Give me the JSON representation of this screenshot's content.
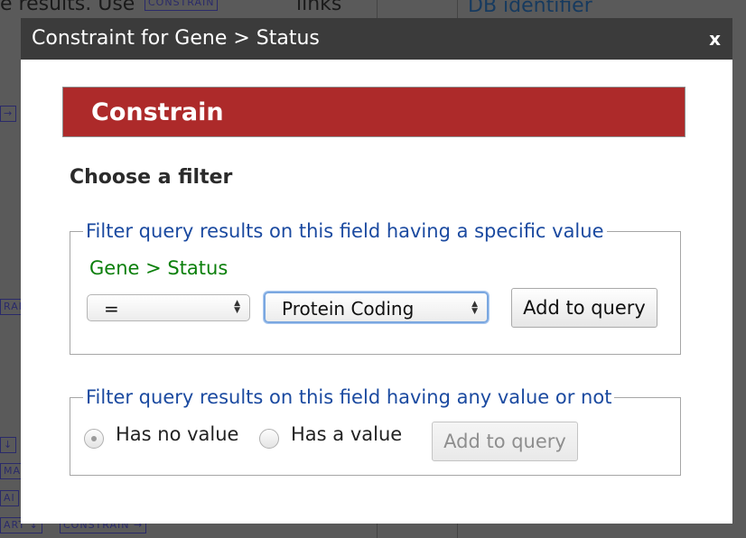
{
  "background": {
    "text_top_left": "e results. Use",
    "box_top": "CONSTRAIN",
    "text_links": "links",
    "db_identifier": "DB identifier",
    "left_box_1": "→",
    "left_box_2": "RAIN",
    "left_box_3": "↓",
    "left_box_4": "MAI",
    "left_box_5": "AI",
    "left_box_6": "ART ↓",
    "bottom_box": "CONSTRAIN →"
  },
  "modal": {
    "title": "Constraint for Gene > Status",
    "close_label": "x",
    "banner": "Constrain",
    "heading": "Choose a filter",
    "specific_value": {
      "legend": "Filter query results on this field having a specific value",
      "field_path": "Gene > Status",
      "operator": "=",
      "value": "Protein Coding",
      "button": "Add to query"
    },
    "any_value": {
      "legend": "Filter query results on this field having any value or not",
      "option_no_value": "Has no value",
      "option_has_value": "Has a value",
      "selected": "Has no value",
      "button": "Add to query",
      "button_disabled": true
    }
  },
  "colors": {
    "banner": "#ad2a2a",
    "legend": "#1b4aa0",
    "field_path": "#0a7f0a",
    "header": "#3b3b3b"
  }
}
